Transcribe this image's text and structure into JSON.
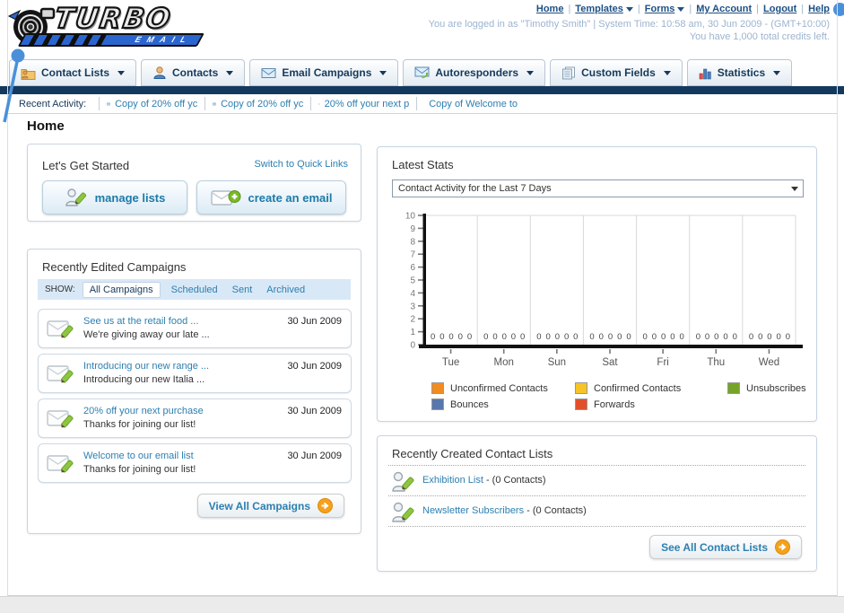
{
  "colors": {
    "navy": "#14395e",
    "link_dark": "#1d5084",
    "link_teal": "#2d7fb0",
    "muted_blue": "#9cb4d0",
    "callout_blue": "#4a90d9"
  },
  "logo": {
    "title": "TURBO",
    "subtitle": "EMAIL"
  },
  "header": {
    "links": [
      {
        "label": "Home",
        "dropdown": false
      },
      {
        "label": "Templates",
        "dropdown": true
      },
      {
        "label": "Forms",
        "dropdown": true
      },
      {
        "label": "My Account",
        "dropdown": false
      },
      {
        "label": "Logout",
        "dropdown": false
      },
      {
        "label": "Help",
        "dropdown": false
      }
    ],
    "login_info": "You are logged in as \"Timothy Smith\" | System Time: 10:58 am, 30 Jun 2009 - (GMT+10:00)",
    "credits_info": "You have 1,000 total credits left."
  },
  "nav": {
    "tabs": [
      {
        "label": "Contact Lists"
      },
      {
        "label": "Contacts"
      },
      {
        "label": "Email Campaigns"
      },
      {
        "label": "Autoresponders"
      },
      {
        "label": "Custom Fields"
      },
      {
        "label": "Statistics"
      }
    ]
  },
  "recent_activity": {
    "label": "Recent Activity:",
    "items": [
      "Copy of 20% off yc",
      "Copy of 20% off yc",
      "20% off your next p",
      "Copy of Welcome to"
    ]
  },
  "home": {
    "title": "Home"
  },
  "get_started": {
    "title": "Let's Get Started",
    "switch_link": "Switch to Quick Links",
    "manage_button": "manage lists",
    "create_button": "create an email"
  },
  "campaigns": {
    "title": "Recently Edited Campaigns",
    "show_label": "SHOW:",
    "filters": [
      "All Campaigns",
      "Scheduled",
      "Sent",
      "Archived"
    ],
    "active_filter": "All Campaigns",
    "items": [
      {
        "title": "See us at the retail food ...",
        "subtitle": "We're giving away our late ...",
        "date": "30 Jun 2009"
      },
      {
        "title": "Introducing our new range ...",
        "subtitle": "Introducing our new Italia ...",
        "date": "30 Jun 2009"
      },
      {
        "title": "20% off your next purchase",
        "subtitle": "Thanks for joining our list!",
        "date": "30 Jun 2009"
      },
      {
        "title": "Welcome to our email list",
        "subtitle": "Thanks for joining our list!",
        "date": "30 Jun 2009"
      }
    ],
    "view_all": "View All Campaigns"
  },
  "stats": {
    "title": "Latest Stats",
    "dropdown_value": "Contact Activity for the Last 7 Days"
  },
  "chart_data": {
    "type": "bar",
    "title": "Contact Activity for the Last 7 Days",
    "categories": [
      "Tue",
      "Mon",
      "Sun",
      "Sat",
      "Fri",
      "Thu",
      "Wed"
    ],
    "series": [
      {
        "name": "Unconfirmed Contacts",
        "color": "#f28b21",
        "values": [
          0,
          0,
          0,
          0,
          0,
          0,
          0
        ]
      },
      {
        "name": "Confirmed Contacts",
        "color": "#f6c426",
        "values": [
          0,
          0,
          0,
          0,
          0,
          0,
          0
        ]
      },
      {
        "name": "Unsubscribes",
        "color": "#76a428",
        "values": [
          0,
          0,
          0,
          0,
          0,
          0,
          0
        ]
      },
      {
        "name": "Bounces",
        "color": "#5877ac",
        "values": [
          0,
          0,
          0,
          0,
          0,
          0,
          0
        ]
      },
      {
        "name": "Forwards",
        "color": "#e2502a",
        "values": [
          0,
          0,
          0,
          0,
          0,
          0,
          0
        ]
      }
    ],
    "ylim": [
      0,
      10
    ],
    "ytick_step": 1,
    "grid": "vertical-group-separators",
    "value_labels": true,
    "legend_position": "bottom"
  },
  "contact_lists": {
    "title": "Recently Created Contact Lists",
    "items": [
      {
        "name": "Exhibition List",
        "count": "- (0 Contacts)"
      },
      {
        "name": "Newsletter Subscribers",
        "count": "- (0 Contacts)"
      }
    ],
    "see_all": "See All Contact Lists"
  }
}
